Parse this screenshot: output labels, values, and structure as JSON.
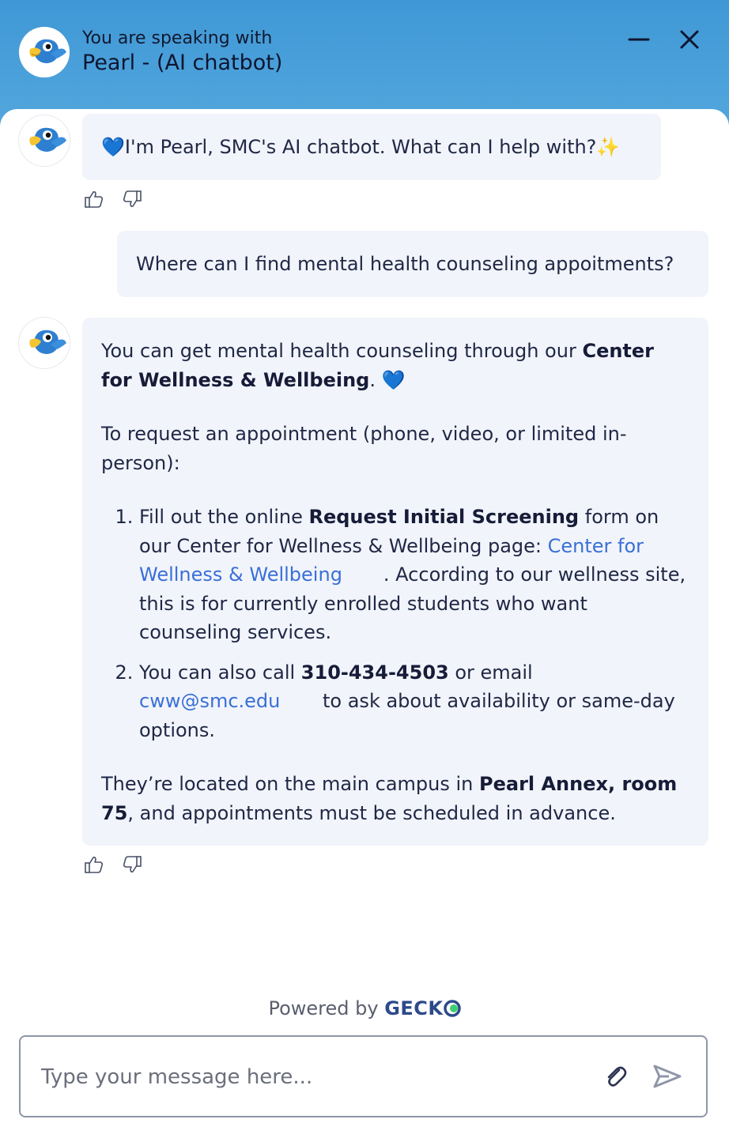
{
  "header": {
    "subtitle": "You are speaking with",
    "title": "Pearl - (AI chatbot)"
  },
  "messages": {
    "m1": {
      "emoji": "💙",
      "text": " I'm Pearl, SMC's AI chatbot. What can I help with?",
      "sparkle": "✨"
    },
    "m2": {
      "text": "Where can I find mental health counseling appoitments?"
    },
    "m3": {
      "p1_pre": "You can get mental health counseling through our ",
      "p1_bold": "Center for Wellness & Wellbeing",
      "p1_post": ". ",
      "p1_emoji": "💙",
      "p2": "To request an appointment (phone, video, or limited in-person):",
      "li1_pre": "Fill out the online ",
      "li1_bold": "Request Initial Screening",
      "li1_mid": " form on our Center for Wellness & Wellbeing page: ",
      "li1_link": "Center for Wellness & Wellbeing",
      "li1_post": ". According to our wellness site, this is for currently enrolled students who want counseling services.",
      "li2_pre": "You can also call ",
      "li2_bold": "310-434-4503",
      "li2_mid": " or email ",
      "li2_link": "cww@smc.edu",
      "li2_post": " to ask about availability or same-day options.",
      "p3_pre": "They’re located on the main campus in ",
      "p3_bold": "Pearl Annex, room 75",
      "p3_post": ", and appointments must be scheduled in advance."
    }
  },
  "footer": {
    "powered_by": "Powered by ",
    "brand": "GECK",
    "input_placeholder": "Type your message here..."
  },
  "colors": {
    "header_top": "#3f98d5",
    "bubble_bg": "#f1f4fa",
    "link": "#3a6fd8",
    "brand_dot": "#3ecf6e"
  }
}
